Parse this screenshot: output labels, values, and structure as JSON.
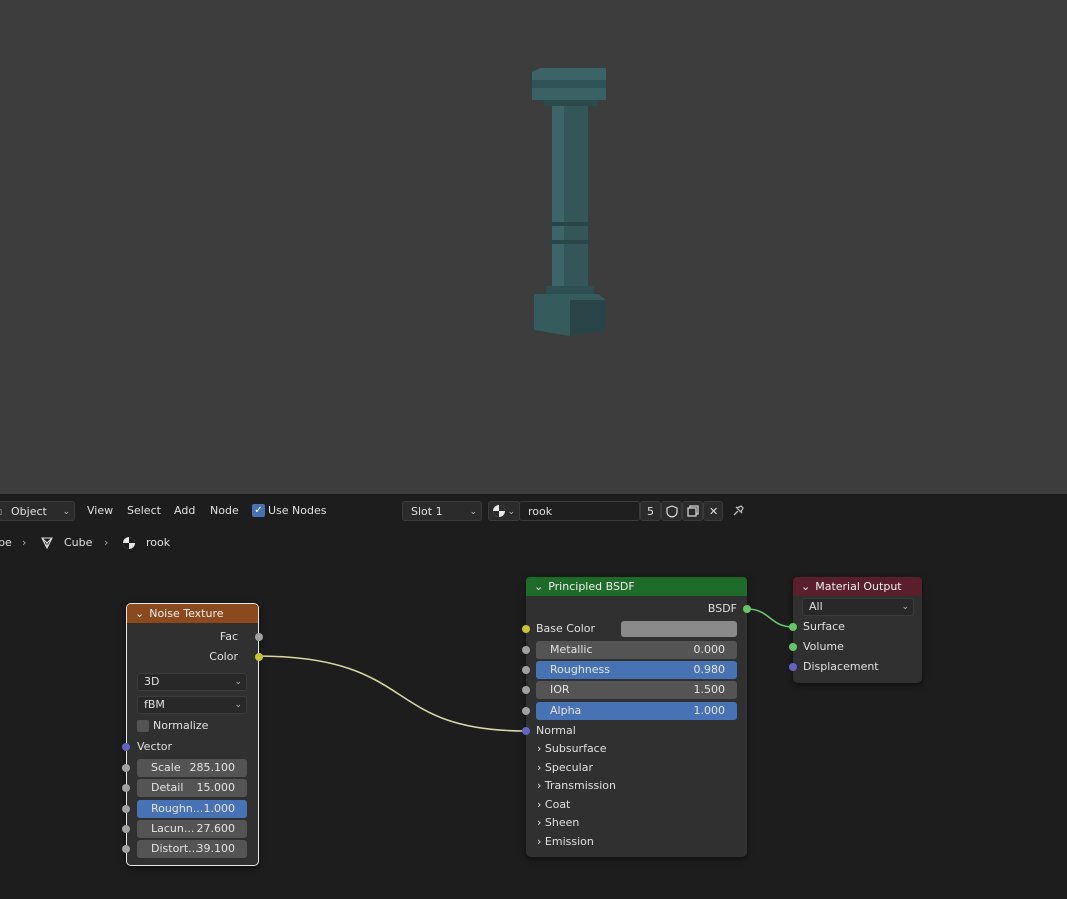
{
  "header": {
    "mode": "Object",
    "menus": [
      "View",
      "Select",
      "Add",
      "Node"
    ],
    "use_nodes_label": "Use Nodes",
    "use_nodes_checked": true,
    "slot": "Slot 1",
    "material_name": "rook",
    "user_count": "5"
  },
  "breadcrumb": {
    "scene_partial": "pe",
    "object": "Cube",
    "material": "rook"
  },
  "noise_node": {
    "title": "Noise Texture",
    "out_fac": "Fac",
    "out_color": "Color",
    "dimension": "3D",
    "type": "fBM",
    "normalize_label": "Normalize",
    "normalize_checked": false,
    "vector_label": "Vector",
    "fields": [
      {
        "label": "Scale",
        "value": "285.100"
      },
      {
        "label": "Detail",
        "value": "15.000"
      },
      {
        "label": "Roughn...",
        "value": "1.000"
      },
      {
        "label": "Lacun...",
        "value": "27.600"
      },
      {
        "label": "Distort...",
        "value": "39.100"
      }
    ]
  },
  "bsdf_node": {
    "title": "Principled BSDF",
    "output": "BSDF",
    "base_color_label": "Base Color",
    "base_color": "#8a8a8a",
    "fields": [
      {
        "label": "Metallic",
        "value": "0.000"
      },
      {
        "label": "Roughness",
        "value": "0.980"
      },
      {
        "label": "IOR",
        "value": "1.500"
      },
      {
        "label": "Alpha",
        "value": "1.000"
      }
    ],
    "normal_label": "Normal",
    "panels": [
      "Subsurface",
      "Specular",
      "Transmission",
      "Coat",
      "Sheen",
      "Emission"
    ]
  },
  "output_node": {
    "title": "Material Output",
    "target": "All",
    "inputs": [
      "Surface",
      "Volume",
      "Displacement"
    ]
  },
  "colors": {
    "viewport_bg": "#3d3d3d",
    "editor_bg": "#1d1d1d",
    "texture_header": "#8b4a1d",
    "shader_header": "#1f6b2a",
    "output_header": "#5a1f2c",
    "accent_blue": "#4772b3",
    "socket_color": "#c7c729",
    "socket_float": "#a1a1a1",
    "socket_vector": "#6363c7",
    "socket_shader": "#63c763"
  }
}
